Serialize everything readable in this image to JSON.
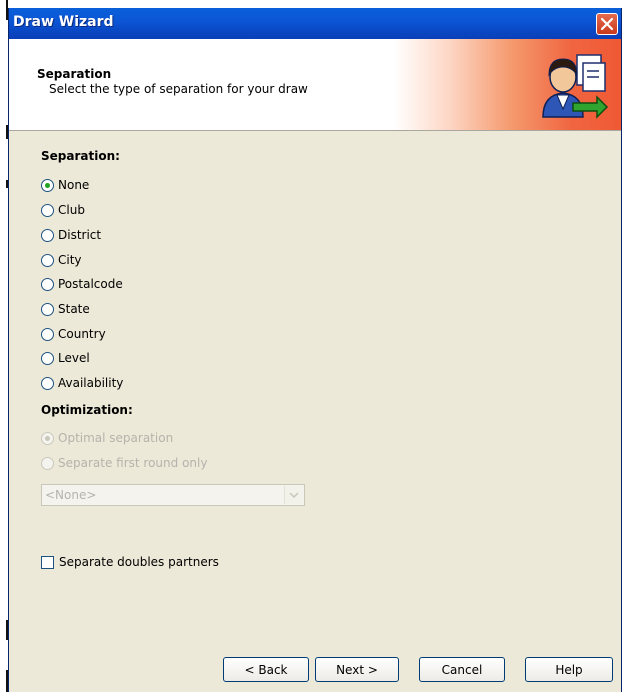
{
  "window": {
    "title": "Draw Wizard"
  },
  "header": {
    "title": "Separation",
    "subtitle": "Select the type of separation for your draw"
  },
  "separation": {
    "label": "Separation:",
    "options": [
      {
        "label": "None",
        "checked": true
      },
      {
        "label": "Club",
        "checked": false
      },
      {
        "label": "District",
        "checked": false
      },
      {
        "label": "City",
        "checked": false
      },
      {
        "label": "Postalcode",
        "checked": false
      },
      {
        "label": "State",
        "checked": false
      },
      {
        "label": "Country",
        "checked": false
      },
      {
        "label": "Level",
        "checked": false
      },
      {
        "label": "Availability",
        "checked": false
      }
    ]
  },
  "optimization": {
    "label": "Optimization:",
    "options": [
      {
        "label": "Optimal separation",
        "checked": true,
        "enabled": false
      },
      {
        "label": "Separate first round only",
        "checked": false,
        "enabled": false
      }
    ],
    "combo_value": "<None>"
  },
  "doubles": {
    "label": "Separate doubles partners",
    "checked": false
  },
  "buttons": {
    "back": "< Back",
    "next": "Next >",
    "cancel": "Cancel",
    "help": "Help"
  },
  "colors": {
    "titlebar": "#0a5fd8",
    "header_accent": "#ef5934",
    "dialog_bg": "#ece9d8"
  }
}
